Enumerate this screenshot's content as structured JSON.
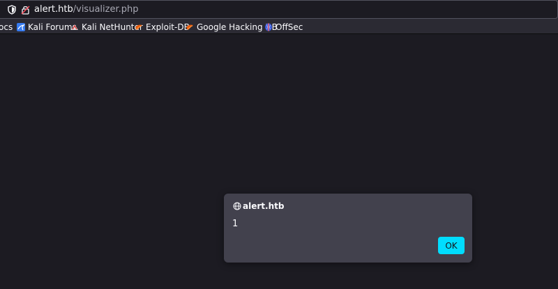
{
  "address_bar": {
    "host": "alert.htb",
    "path": "/visualizer.php"
  },
  "bookmarks": [
    {
      "label": "ocs",
      "icon": "none"
    },
    {
      "label": "Kali Forums",
      "icon": "kali-dragon-icon"
    },
    {
      "label": "Kali NetHunter",
      "icon": "kali-nethunter-icon"
    },
    {
      "label": "Exploit-DB",
      "icon": "exploit-db-icon"
    },
    {
      "label": "Google Hacking DB",
      "icon": "exploit-db-icon"
    },
    {
      "label": "OffSec",
      "icon": "offsec-icon"
    }
  ],
  "dialog": {
    "title": "alert.htb",
    "message": "1",
    "ok_label": "OK"
  },
  "colors": {
    "page_bg": "#1c1b22",
    "toolbar_bg": "#2b2a33",
    "dialog_bg": "#42414d",
    "accent_button": "#00ddff"
  }
}
